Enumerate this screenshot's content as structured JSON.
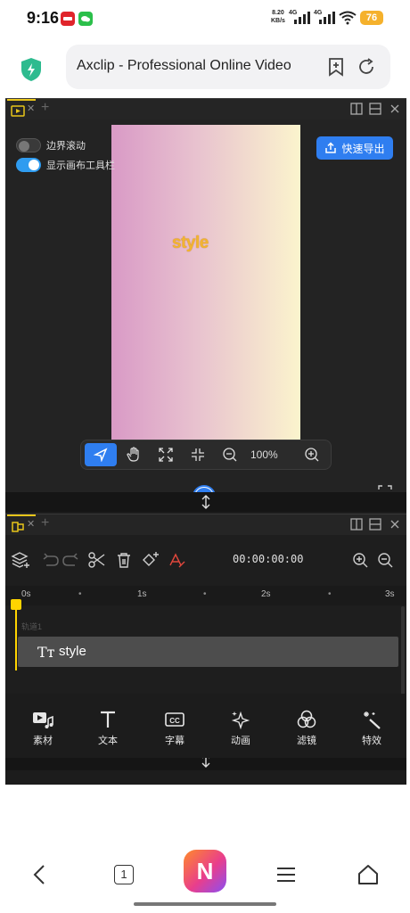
{
  "status_bar": {
    "time": "9:16",
    "net_speed_value": "8.20",
    "net_speed_unit": "KB/s",
    "network_1": "4G",
    "network_2": "4G",
    "battery": "76"
  },
  "browser": {
    "url_title": "Axclip - Professional Online Video",
    "tab_count": "1",
    "app_logo_letter": "N"
  },
  "preview_panel": {
    "toggle_edge_scroll_label": "边界滚动",
    "toggle_edge_scroll_on": false,
    "toggle_canvas_toolbar_label": "显示画布工具栏",
    "toggle_canvas_toolbar_on": true,
    "export_button_label": "快速导出",
    "canvas_text": "style",
    "canvas_gradient": [
      "#d99ac6",
      "#e8c2cf",
      "#fbf4cd"
    ],
    "zoom_level": "100%",
    "canvas_tools": [
      "select-icon",
      "hand-icon",
      "fit-expand-icon",
      "fit-collapse-icon",
      "zoom-out-icon",
      "zoom-in-icon"
    ]
  },
  "timeline_panel": {
    "timecode": "00:00:00:00",
    "ruler_labels": [
      "0s",
      "1s",
      "2s",
      "3s"
    ],
    "track_label": "轨道1",
    "clip_label": "style",
    "tools": [
      "add-track-icon",
      "undo-icon",
      "redo-icon",
      "scissors-icon",
      "delete-icon",
      "add-keyframe-icon",
      "clear-format-icon",
      "zoom-in-icon",
      "zoom-out-icon"
    ]
  },
  "bottom_tabs": [
    {
      "label": "素材",
      "icon": "media-icon"
    },
    {
      "label": "文本",
      "icon": "text-icon"
    },
    {
      "label": "字幕",
      "icon": "caption-icon"
    },
    {
      "label": "动画",
      "icon": "animation-icon"
    },
    {
      "label": "滤镜",
      "icon": "filter-icon"
    },
    {
      "label": "特效",
      "icon": "effects-icon"
    }
  ],
  "colors": {
    "accent_blue": "#2f7ef0",
    "playhead_yellow": "#ffd400",
    "tab_highlight": "#e8c51a",
    "canvas_text": "#f2b431"
  }
}
